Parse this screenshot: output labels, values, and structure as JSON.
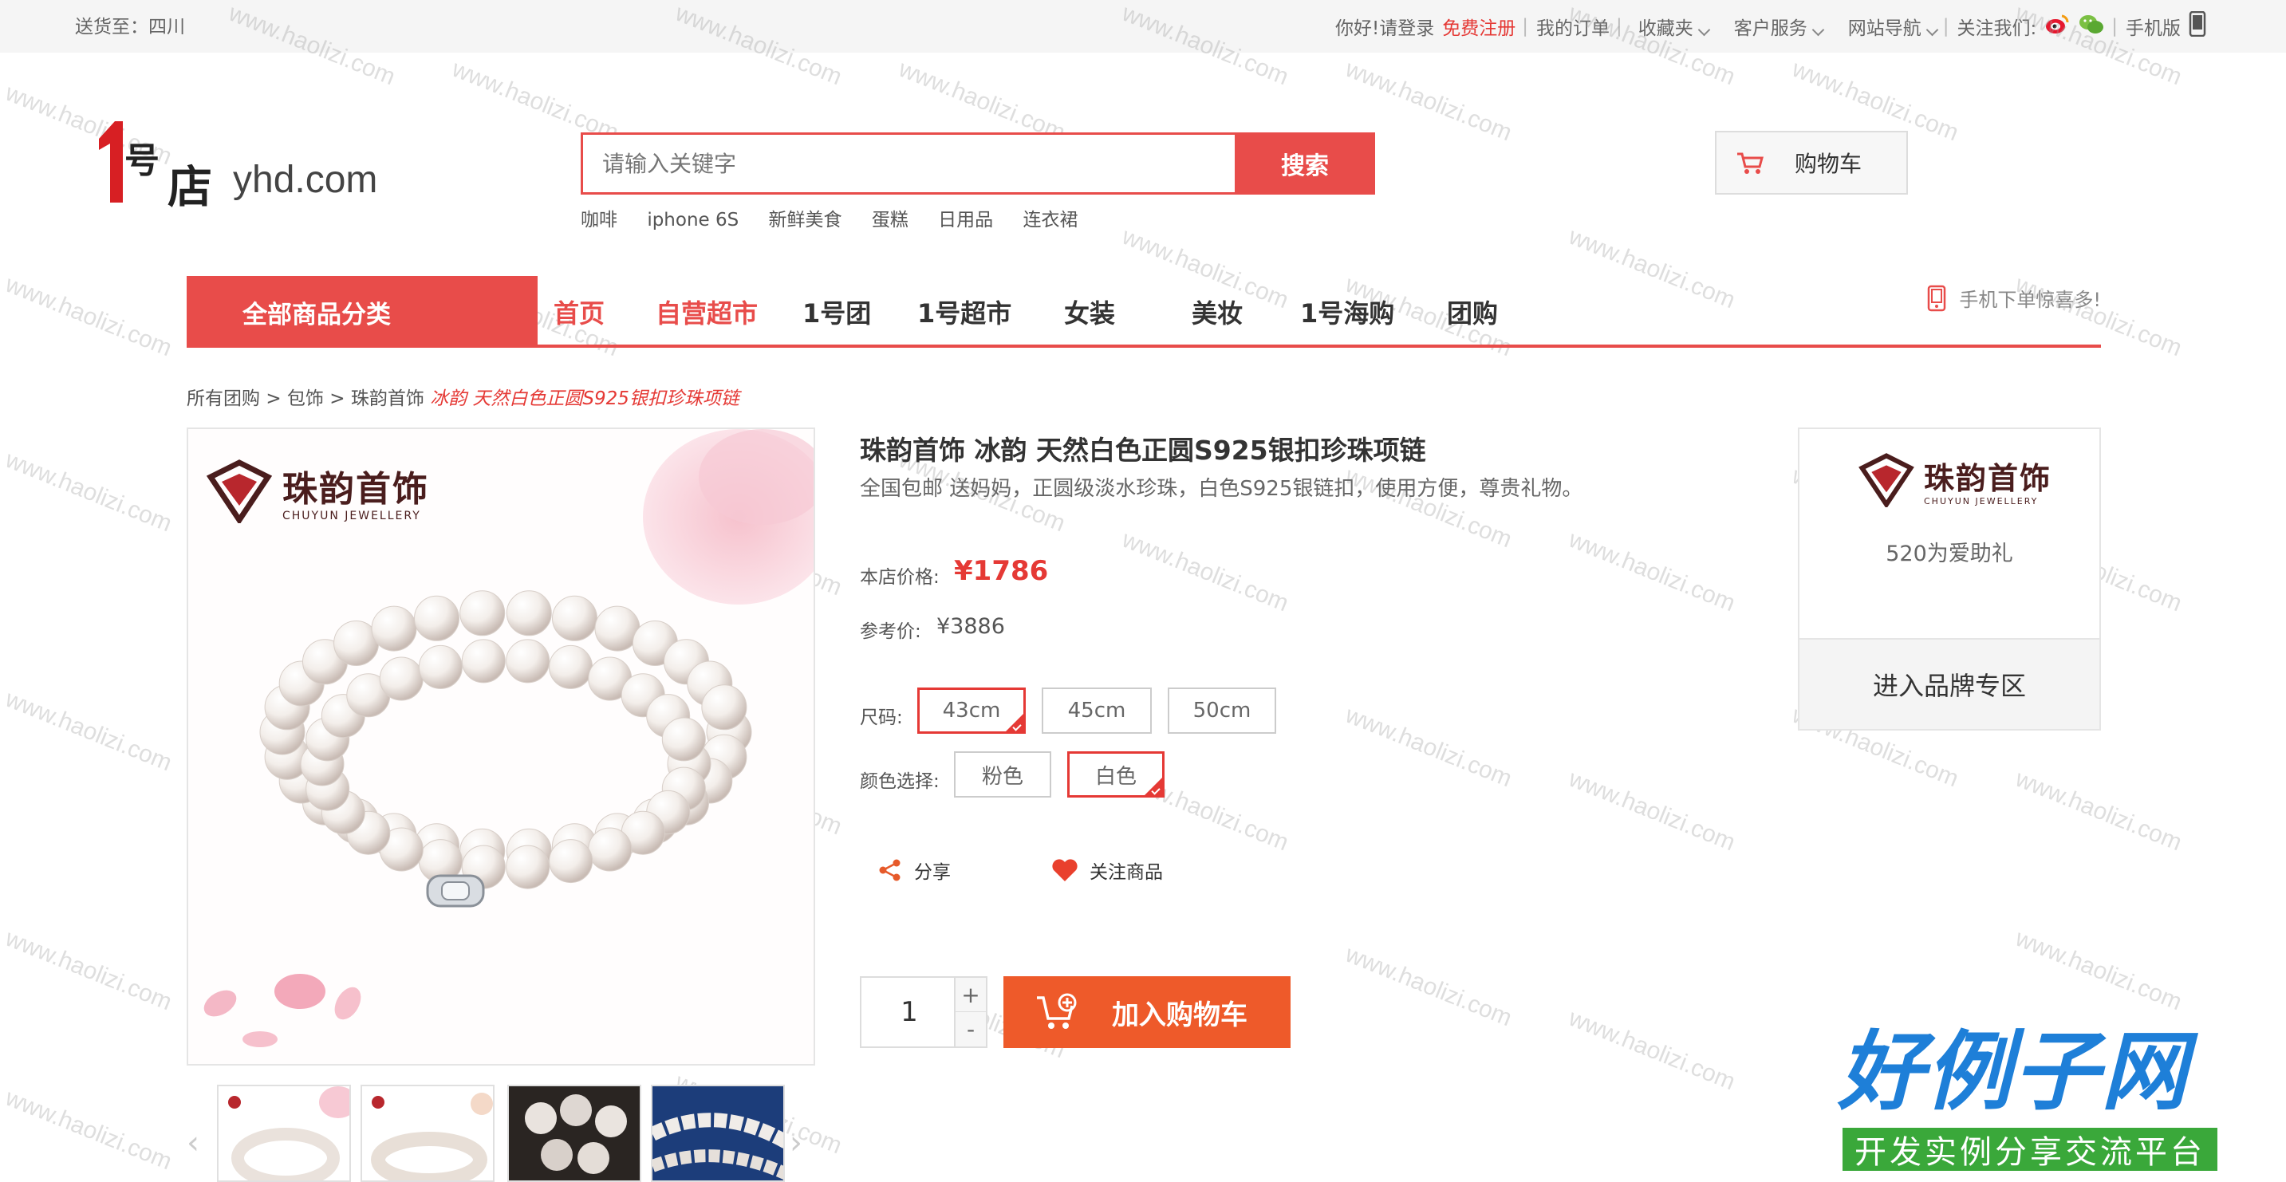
{
  "topbar": {
    "ship_to": "送货至：四川",
    "greeting": "你好!请登录",
    "register": "免费注册",
    "my_orders": "我的订单",
    "favorites": "收藏夹",
    "customer_service": "客户服务",
    "site_nav": "网站导航",
    "follow_us": "关注我们:",
    "mobile": "手机版"
  },
  "logo": {
    "mark": "1号店",
    "domain": "yhd.com"
  },
  "search": {
    "placeholder": "请输入关键字",
    "button": "搜索",
    "hot_words": [
      "咖啡",
      "iphone 6S",
      "新鲜美食",
      "蛋糕",
      "日用品",
      "连衣裙"
    ]
  },
  "cart": {
    "label": "购物车"
  },
  "nav": {
    "all_categories": "全部商品分类",
    "items": [
      "首页",
      "自营超市",
      "1号团",
      "1号超市",
      "女装",
      "美妆",
      "1号海购",
      "团购"
    ],
    "mobile_promo": "手机下单惊喜多!"
  },
  "breadcrumb": {
    "items": [
      "所有团购",
      "包饰",
      "珠韵首饰"
    ],
    "current": "冰韵 天然白色正圆S925银扣珍珠项链"
  },
  "brand": {
    "name_cn": "珠韵首饰",
    "name_en": "CHUYUN JEWELLERY",
    "slogan": "520为爱助礼",
    "enter": "进入品牌专区"
  },
  "product": {
    "title": "珠韵首饰 冰韵 天然白色正圆S925银扣珍珠项链",
    "subtitle": "全国包邮 送妈妈，正圆级淡水珍珠，白色S925银链扣，使用方便，尊贵礼物。",
    "price_label": "本店价格:",
    "price": "¥1786",
    "ref_label": "参考价:",
    "ref_price": "¥3886",
    "size_label": "尺码:",
    "sizes": [
      "43cm",
      "45cm",
      "50cm"
    ],
    "selected_size": "43cm",
    "color_label": "颜色选择:",
    "colors": [
      "粉色",
      "白色"
    ],
    "selected_color": "白色",
    "share": "分享",
    "follow": "关注商品",
    "quantity": "1",
    "plus": "+",
    "minus": "-",
    "add_to_cart": "加入购物车"
  },
  "watermark": "www.haolizi.com",
  "site_badge": {
    "title": "好例子网",
    "subtitle": "开发实例分享交流平台"
  },
  "colors": {
    "accent": "#e84c4a",
    "cart_button": "#ee5a2a",
    "price": "#e53935"
  }
}
